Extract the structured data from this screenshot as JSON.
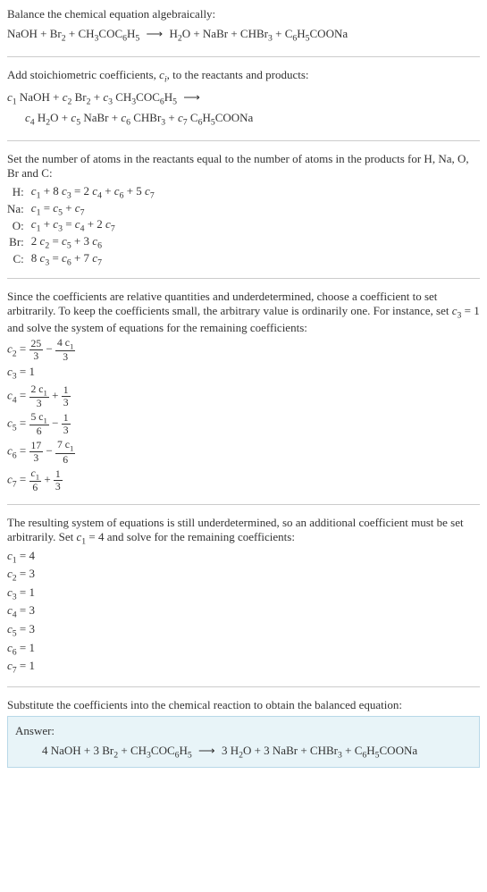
{
  "intro": {
    "title": "Balance the chemical equation algebraically:",
    "equation_lhs": "NaOH + Br",
    "equation_mid1": " + CH",
    "equation_mid2": "COC",
    "equation_mid3": "H",
    "equation_rhs1": "H",
    "equation_rhs2": "O + NaBr + CHBr",
    "equation_rhs3": " + C",
    "equation_rhs4": "H",
    "equation_rhs5": "COONa"
  },
  "stoich": {
    "title_part1": "Add stoichiometric coefficients, ",
    "title_var": "c",
    "title_sub": "i",
    "title_part2": ", to the reactants and products:",
    "line1_c1": "c",
    "line1_naoh": " NaOH + ",
    "line1_c2": "c",
    "line1_br2": " Br",
    "line1_plus1": " + ",
    "line1_c3": "c",
    "line1_ch3": " CH",
    "line1_coc": "COC",
    "line1_h5": "H",
    "line2_c4": "c",
    "line2_h2o": " H",
    "line2_o": "O + ",
    "line2_c5": "c",
    "line2_nabr": " NaBr + ",
    "line2_c6": "c",
    "line2_chbr3": " CHBr",
    "line2_plus": " + ",
    "line2_c7": "c",
    "line2_c6h5": " C",
    "line2_h5_2": "H",
    "line2_coona": "COONa"
  },
  "atoms": {
    "title": "Set the number of atoms in the reactants equal to the number of atoms in the products for H, Na, O, Br and C:",
    "rows": [
      {
        "label": "H:",
        "eq_p1": "c",
        "eq_p2": " + 8 ",
        "eq_p3": "c",
        "eq_p4": " = 2 ",
        "eq_p5": "c",
        "eq_p6": " + ",
        "eq_p7": "c",
        "eq_p8": " + 5 ",
        "eq_p9": "c",
        "s1": "1",
        "s2": "3",
        "s3": "4",
        "s4": "6",
        "s5": "7"
      },
      {
        "label": "Na:",
        "eq_p1": "c",
        "eq_p2": " = ",
        "eq_p3": "c",
        "eq_p4": " + ",
        "eq_p5": "c",
        "s1": "1",
        "s2": "5",
        "s3": "7"
      },
      {
        "label": "O:",
        "eq_p1": "c",
        "eq_p2": " + ",
        "eq_p3": "c",
        "eq_p4": " = ",
        "eq_p5": "c",
        "eq_p6": " + 2 ",
        "eq_p7": "c",
        "s1": "1",
        "s2": "3",
        "s3": "4",
        "s4": "7"
      },
      {
        "label": "Br:",
        "eq_p1": "2 ",
        "eq_p2": "c",
        "eq_p3": " = ",
        "eq_p4": "c",
        "eq_p5": " + 3 ",
        "eq_p6": "c",
        "s1": "2",
        "s2": "5",
        "s3": "6"
      },
      {
        "label": "C:",
        "eq_p1": "8 ",
        "eq_p2": "c",
        "eq_p3": " = ",
        "eq_p4": "c",
        "eq_p5": " + 7 ",
        "eq_p6": "c",
        "s1": "3",
        "s2": "6",
        "s3": "7"
      }
    ]
  },
  "underdetermined": {
    "text_p1": "Since the coefficients are relative quantities and underdetermined, choose a coefficient to set arbitrarily. To keep the coefficients small, the arbitrary value is ordinarily one. For instance, set ",
    "text_var": "c",
    "text_sub": "3",
    "text_p2": " = 1 and solve the system of equations for the remaining coefficients:",
    "c2_lhs": "c",
    "c2_sub": "2",
    "c2_eq": " = ",
    "c2_f1n": "25",
    "c2_f1d": "3",
    "c2_minus": " − ",
    "c2_f2n": "4 c",
    "c2_f2n_sub": "1",
    "c2_f2d": "3",
    "c3_lhs": "c",
    "c3_sub": "3",
    "c3_eq": " = 1",
    "c4_lhs": "c",
    "c4_sub": "4",
    "c4_eq": " = ",
    "c4_f1n": "2 c",
    "c4_f1n_sub": "1",
    "c4_f1d": "3",
    "c4_plus": " + ",
    "c4_f2n": "1",
    "c4_f2d": "3",
    "c5_lhs": "c",
    "c5_sub": "5",
    "c5_eq": " = ",
    "c5_f1n": "5 c",
    "c5_f1n_sub": "1",
    "c5_f1d": "6",
    "c5_minus": " − ",
    "c5_f2n": "1",
    "c5_f2d": "3",
    "c6_lhs": "c",
    "c6_sub": "6",
    "c6_eq": " = ",
    "c6_f1n": "17",
    "c6_f1d": "3",
    "c6_minus": " − ",
    "c6_f2n": "7 c",
    "c6_f2n_sub": "1",
    "c6_f2d": "6",
    "c7_lhs": "c",
    "c7_sub": "7",
    "c7_eq": " = ",
    "c7_f1n": "c",
    "c7_f1n_sub": "1",
    "c7_f1d": "6",
    "c7_plus": " + ",
    "c7_f2n": "1",
    "c7_f2d": "3"
  },
  "resulting": {
    "text_p1": "The resulting system of equations is still underdetermined, so an additional coefficient must be set arbitrarily. Set ",
    "text_var": "c",
    "text_sub": "1",
    "text_p2": " = 4 and solve for the remaining coefficients:",
    "lines": [
      {
        "var": "c",
        "sub": "1",
        "val": " = 4"
      },
      {
        "var": "c",
        "sub": "2",
        "val": " = 3"
      },
      {
        "var": "c",
        "sub": "3",
        "val": " = 1"
      },
      {
        "var": "c",
        "sub": "4",
        "val": " = 3"
      },
      {
        "var": "c",
        "sub": "5",
        "val": " = 3"
      },
      {
        "var": "c",
        "sub": "6",
        "val": " = 1"
      },
      {
        "var": "c",
        "sub": "7",
        "val": " = 1"
      }
    ]
  },
  "substitute": {
    "text": "Substitute the coefficients into the chemical reaction to obtain the balanced equation:"
  },
  "answer": {
    "label": "Answer:",
    "eq_p1": "4 NaOH + 3 Br",
    "eq_p2": " + CH",
    "eq_p3": "COC",
    "eq_p4": "H",
    "eq_p5": "3 H",
    "eq_p6": "O + 3 NaBr + CHBr",
    "eq_p7": " + C",
    "eq_p8": "H",
    "eq_p9": "COONa"
  },
  "arrow": "⟶"
}
